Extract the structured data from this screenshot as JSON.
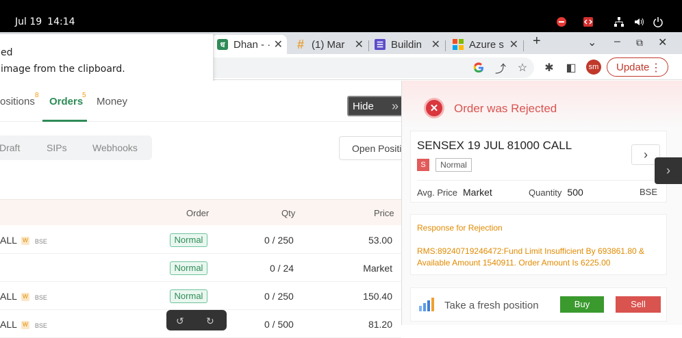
{
  "system": {
    "date": "Jul 19",
    "time": "14:14"
  },
  "tabs": [
    {
      "label": "Dhan - ·",
      "favicon": "dhan-logo-icon",
      "active": true
    },
    {
      "label": "(1) Mar",
      "favicon": "hashtag-icon"
    },
    {
      "label": "Buildin",
      "favicon": "list-icon"
    },
    {
      "label": "Azure s",
      "favicon": "microsoft-icon"
    }
  ],
  "browser": {
    "update_label": "Update",
    "avatar": "sm"
  },
  "notification": {
    "line1": "ed",
    "line2": "image from the clipboard."
  },
  "subnav": {
    "positions": "ositions",
    "positions_count": "8",
    "orders": "Orders",
    "orders_count": "5",
    "money": "Money"
  },
  "hide_button": {
    "label": "Hide"
  },
  "filters": [
    "Draft",
    "SIPs",
    "Webhooks"
  ],
  "open_positions_label": "Open Positi",
  "table": {
    "headers": {
      "order": "Order",
      "qty": "Qty",
      "price": "Price"
    },
    "rows": [
      {
        "name": "ALL",
        "w": "W",
        "exch": "BSE",
        "order": "Normal",
        "qty": "0 / 250",
        "price": "53.00"
      },
      {
        "name": "",
        "w": "",
        "exch": "",
        "order": "Normal",
        "qty": "0 / 24",
        "price": "Market"
      },
      {
        "name": "ALL",
        "w": "W",
        "exch": "BSE",
        "order": "Normal",
        "qty": "0 / 250",
        "price": "150.40"
      },
      {
        "name": "ALL",
        "w": "W",
        "exch": "BSE",
        "order": "",
        "qty": "0 / 500",
        "price": "81.20"
      }
    ]
  },
  "rejection": {
    "title": "Order was Rejected",
    "symbol": "SENSEX 19 JUL 81000 CALL",
    "side_badge": "S",
    "product_badge": "Normal",
    "avg_price_label": "Avg. Price",
    "avg_price_value": "Market",
    "quantity_label": "Quantity",
    "quantity_value": "500",
    "exchange": "BSE",
    "response_title": "Response for Rejection",
    "response_text": "RMS:89240719246472:Fund Limit Insufficient By 693861.80 & Available Amount 1540911. Order Amount Is 6225.00",
    "fresh_position": "Take a fresh position",
    "buy": "Buy",
    "sell": "Sell"
  },
  "colors": {
    "accent_green": "#2e8b57",
    "reject_red": "#d9534f",
    "warn_orange": "#e08a00"
  }
}
